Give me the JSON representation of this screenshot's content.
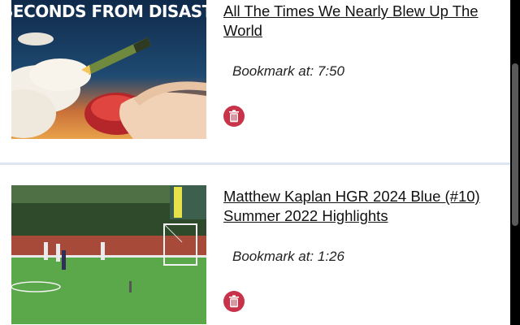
{
  "items": [
    {
      "title": "All The Times We Nearly Blew Up The World",
      "bookmark": "Bookmark at: 7:50",
      "thumbnail_caption": "SECONDS FROM DISASTER",
      "thumbnail_icon": "missile-launch-illustration"
    },
    {
      "title": "Matthew Kaplan HGR 2024 Blue (#10) Summer 2022 Highlights",
      "bookmark": "Bookmark at: 1:26",
      "thumbnail_icon": "lacrosse-field-photo"
    }
  ],
  "colors": {
    "delete_button": "#c8334a",
    "divider": "#dde6ee",
    "scrollbar_thumb": "#5a5a5a"
  }
}
